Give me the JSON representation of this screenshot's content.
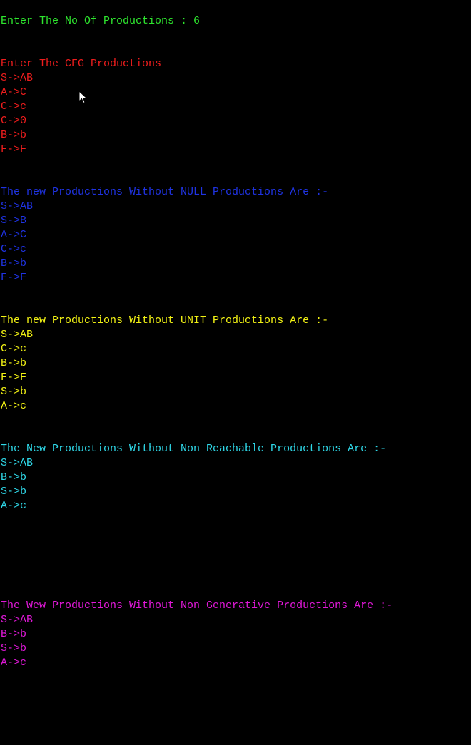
{
  "prompt": {
    "text": "Enter The No Of Productions : 6",
    "color": "#2ee52e"
  },
  "input_section": {
    "title": "Enter The CFG Productions",
    "color": "#ee1d1d",
    "productions": [
      "S->AB",
      "A->C",
      "C->c",
      "C->0",
      "B->b",
      "F->F"
    ]
  },
  "null_section": {
    "title": "The new Productions Without NULL Productions Are :-",
    "color": "#1f33e3",
    "productions": [
      "S->AB",
      "S->B",
      "A->C",
      "C->c",
      "B->b",
      "F->F"
    ]
  },
  "unit_section": {
    "title": "The new Productions Without UNIT Productions Are :-",
    "color": "#f2f214",
    "productions": [
      "S->AB",
      "C->c",
      "B->b",
      "F->F",
      "S->b",
      "A->c"
    ]
  },
  "reachable_section": {
    "title": "The New Productions Without Non Reachable Productions Are :-",
    "color": "#2fd8e8",
    "productions": [
      "S->AB",
      "B->b",
      "S->b",
      "A->c"
    ]
  },
  "generative_section": {
    "title": "The Wew Productions Without Non Generative Productions Are :-",
    "color": "#e018d8",
    "productions": [
      "S->AB",
      "B->b",
      "S->b",
      "A->c"
    ]
  },
  "mouse_cursor": "arrow-pointer-icon"
}
